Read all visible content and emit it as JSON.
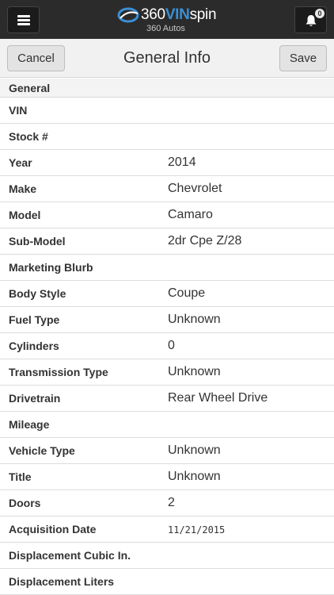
{
  "header": {
    "brand_prefix": "360",
    "brand_accent": "VIN",
    "brand_suffix": "spin",
    "subtitle": "360 Autos",
    "notification_count": "0",
    "icons": {
      "menu": "hamburger-menu-icon",
      "notifications": "bell-icon",
      "logo": "logo-swoosh-icon"
    },
    "colors": {
      "topbar": "#2b2b2b",
      "accent": "#3a8fd6"
    }
  },
  "toolbar": {
    "cancel_label": "Cancel",
    "title": "General Info",
    "save_label": "Save"
  },
  "section": {
    "title": "General"
  },
  "fields": [
    {
      "label": "VIN",
      "value": ""
    },
    {
      "label": "Stock #",
      "value": ""
    },
    {
      "label": "Year",
      "value": "2014"
    },
    {
      "label": "Make",
      "value": "Chevrolet"
    },
    {
      "label": "Model",
      "value": "Camaro"
    },
    {
      "label": "Sub-Model",
      "value": "2dr Cpe Z/28"
    },
    {
      "label": "Marketing Blurb",
      "value": ""
    },
    {
      "label": "Body Style",
      "value": "Coupe"
    },
    {
      "label": "Fuel Type",
      "value": "Unknown"
    },
    {
      "label": "Cylinders",
      "value": "0"
    },
    {
      "label": "Transmission Type",
      "value": "Unknown"
    },
    {
      "label": "Drivetrain",
      "value": "Rear Wheel Drive"
    },
    {
      "label": "Mileage",
      "value": ""
    },
    {
      "label": "Vehicle Type",
      "value": "Unknown"
    },
    {
      "label": "Title",
      "value": "Unknown"
    },
    {
      "label": "Doors",
      "value": "2"
    },
    {
      "label": "Acquisition Date",
      "value": "11/21/2015"
    },
    {
      "label": "Displacement Cubic In.",
      "value": ""
    },
    {
      "label": "Displacement Liters",
      "value": ""
    }
  ]
}
